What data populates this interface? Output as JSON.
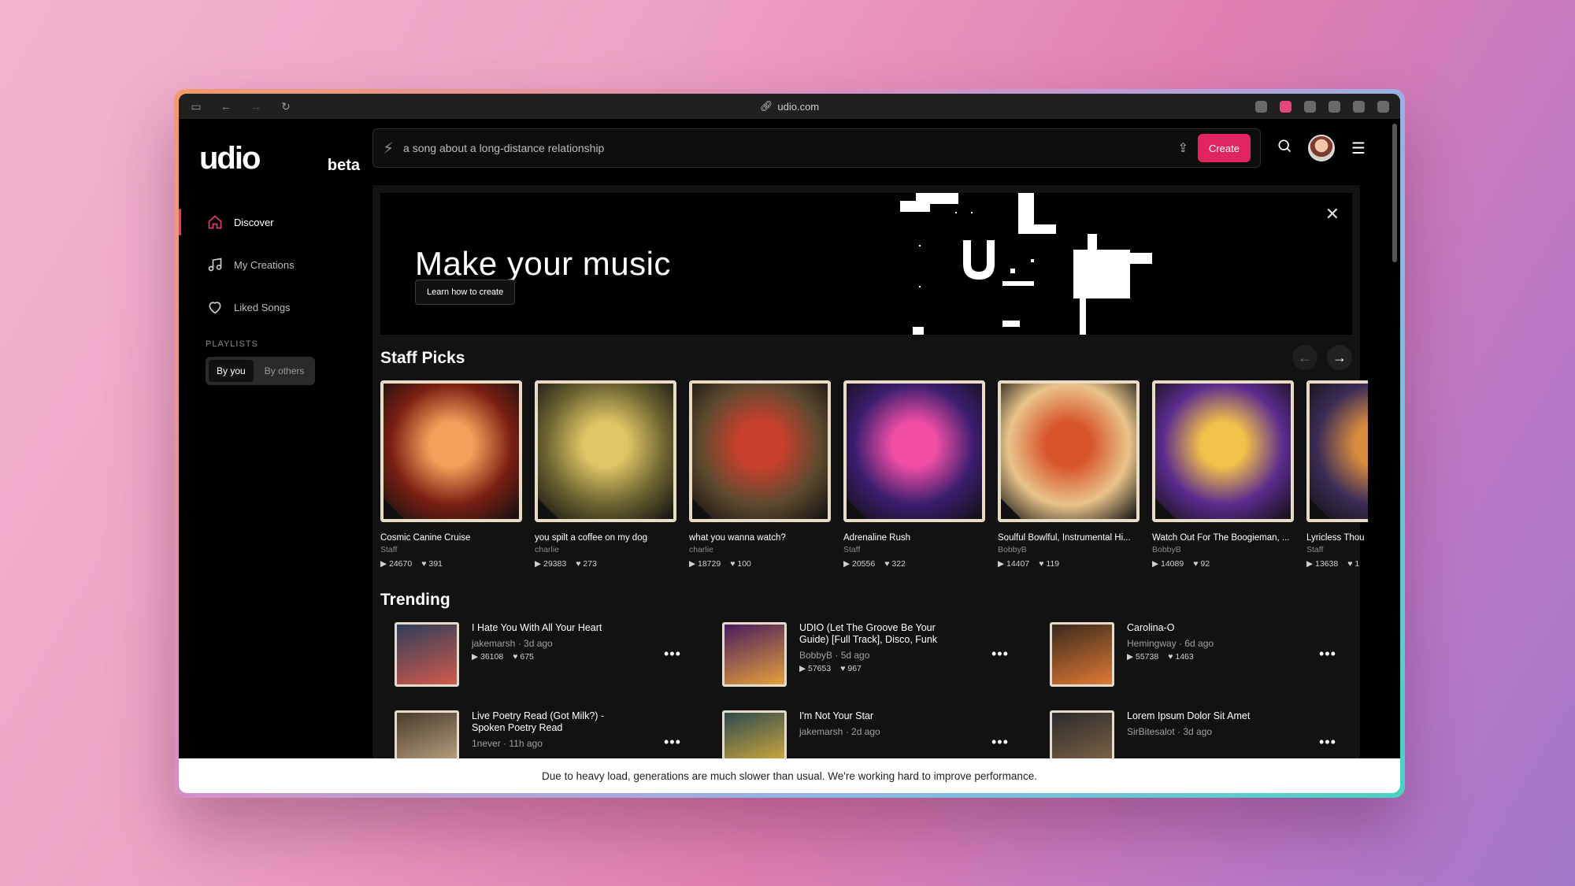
{
  "browser": {
    "url": "udio.com"
  },
  "logo": {
    "main": "udio",
    "beta": "beta"
  },
  "sidebar": {
    "items": [
      {
        "label": "Discover"
      },
      {
        "label": "My Creations"
      },
      {
        "label": "Liked Songs"
      }
    ],
    "playlists_title": "PLAYLISTS",
    "seg": [
      "By you",
      "By others"
    ]
  },
  "search": {
    "placeholder": "a song about a long-distance relationship"
  },
  "create_label": "Create",
  "hero": {
    "title": "Make your music",
    "button": "Learn how to create"
  },
  "staff_picks": {
    "title": "Staff Picks",
    "cards": [
      {
        "title": "Cosmic Canine Cruise",
        "author": "Staff",
        "plays": "24670",
        "likes": "391",
        "c1": "#7a1f12",
        "c2": "#f2a05a"
      },
      {
        "title": "you spilt a coffee on my dog",
        "author": "charlie",
        "plays": "29383",
        "likes": "273",
        "c1": "#6b6330",
        "c2": "#e0c566"
      },
      {
        "title": "what you wanna watch?",
        "author": "charlie",
        "plays": "18729",
        "likes": "100",
        "c1": "#5e4a2e",
        "c2": "#c9402d"
      },
      {
        "title": "Adrenaline Rush",
        "author": "Staff",
        "plays": "20556",
        "likes": "322",
        "c1": "#3a1d6e",
        "c2": "#f04ea5"
      },
      {
        "title": "Soulful Bowlful, Instrumental Hi...",
        "author": "BobbyB",
        "plays": "14407",
        "likes": "119",
        "c1": "#e9c48a",
        "c2": "#d8542b"
      },
      {
        "title": "Watch Out For The Boogieman, ...",
        "author": "BobbyB",
        "plays": "14089",
        "likes": "92",
        "c1": "#5b2b8e",
        "c2": "#f2c14a"
      },
      {
        "title": "Lyricless Thou",
        "author": "Staff",
        "plays": "13638",
        "likes": "1",
        "c1": "#3b2c56",
        "c2": "#d98c3d"
      }
    ]
  },
  "trending": {
    "title": "Trending",
    "items": [
      {
        "title": "I Hate You With All Your Heart",
        "author": "jakemarsh",
        "age": "3d ago",
        "plays": "36108",
        "likes": "675",
        "c1": "#2f3e5a",
        "c2": "#d25a4b"
      },
      {
        "title": "UDIO (Let The Groove Be Your Guide) [Full Track], Disco, Funk",
        "author": "BobbyB",
        "age": "5d ago",
        "plays": "57653",
        "likes": "967",
        "c1": "#4a1c5e",
        "c2": "#e5a13b"
      },
      {
        "title": "Carolina-O",
        "author": "Hemingway",
        "age": "6d ago",
        "plays": "55738",
        "likes": "1463",
        "c1": "#3a2a1c",
        "c2": "#e07a35"
      },
      {
        "title": "Live Poetry Read (Got Milk?) - Spoken Poetry Read",
        "author": "1never",
        "age": "11h ago",
        "plays": "",
        "likes": "",
        "c1": "#4a3b2c",
        "c2": "#c9b08a"
      },
      {
        "title": "I'm Not Your Star",
        "author": "jakemarsh",
        "age": "2d ago",
        "plays": "",
        "likes": "",
        "c1": "#2e4a4e",
        "c2": "#e8b83a"
      },
      {
        "title": "Lorem Ipsum Dolor Sit Amet",
        "author": "SirBitesalot",
        "age": "3d ago",
        "plays": "",
        "likes": "",
        "c1": "#2b2b2b",
        "c2": "#8a6b4a"
      }
    ]
  },
  "banner": "Due to heavy load, generations are much slower than usual. We're working hard to improve performance.",
  "colors": {
    "accent": "#e2245e"
  }
}
